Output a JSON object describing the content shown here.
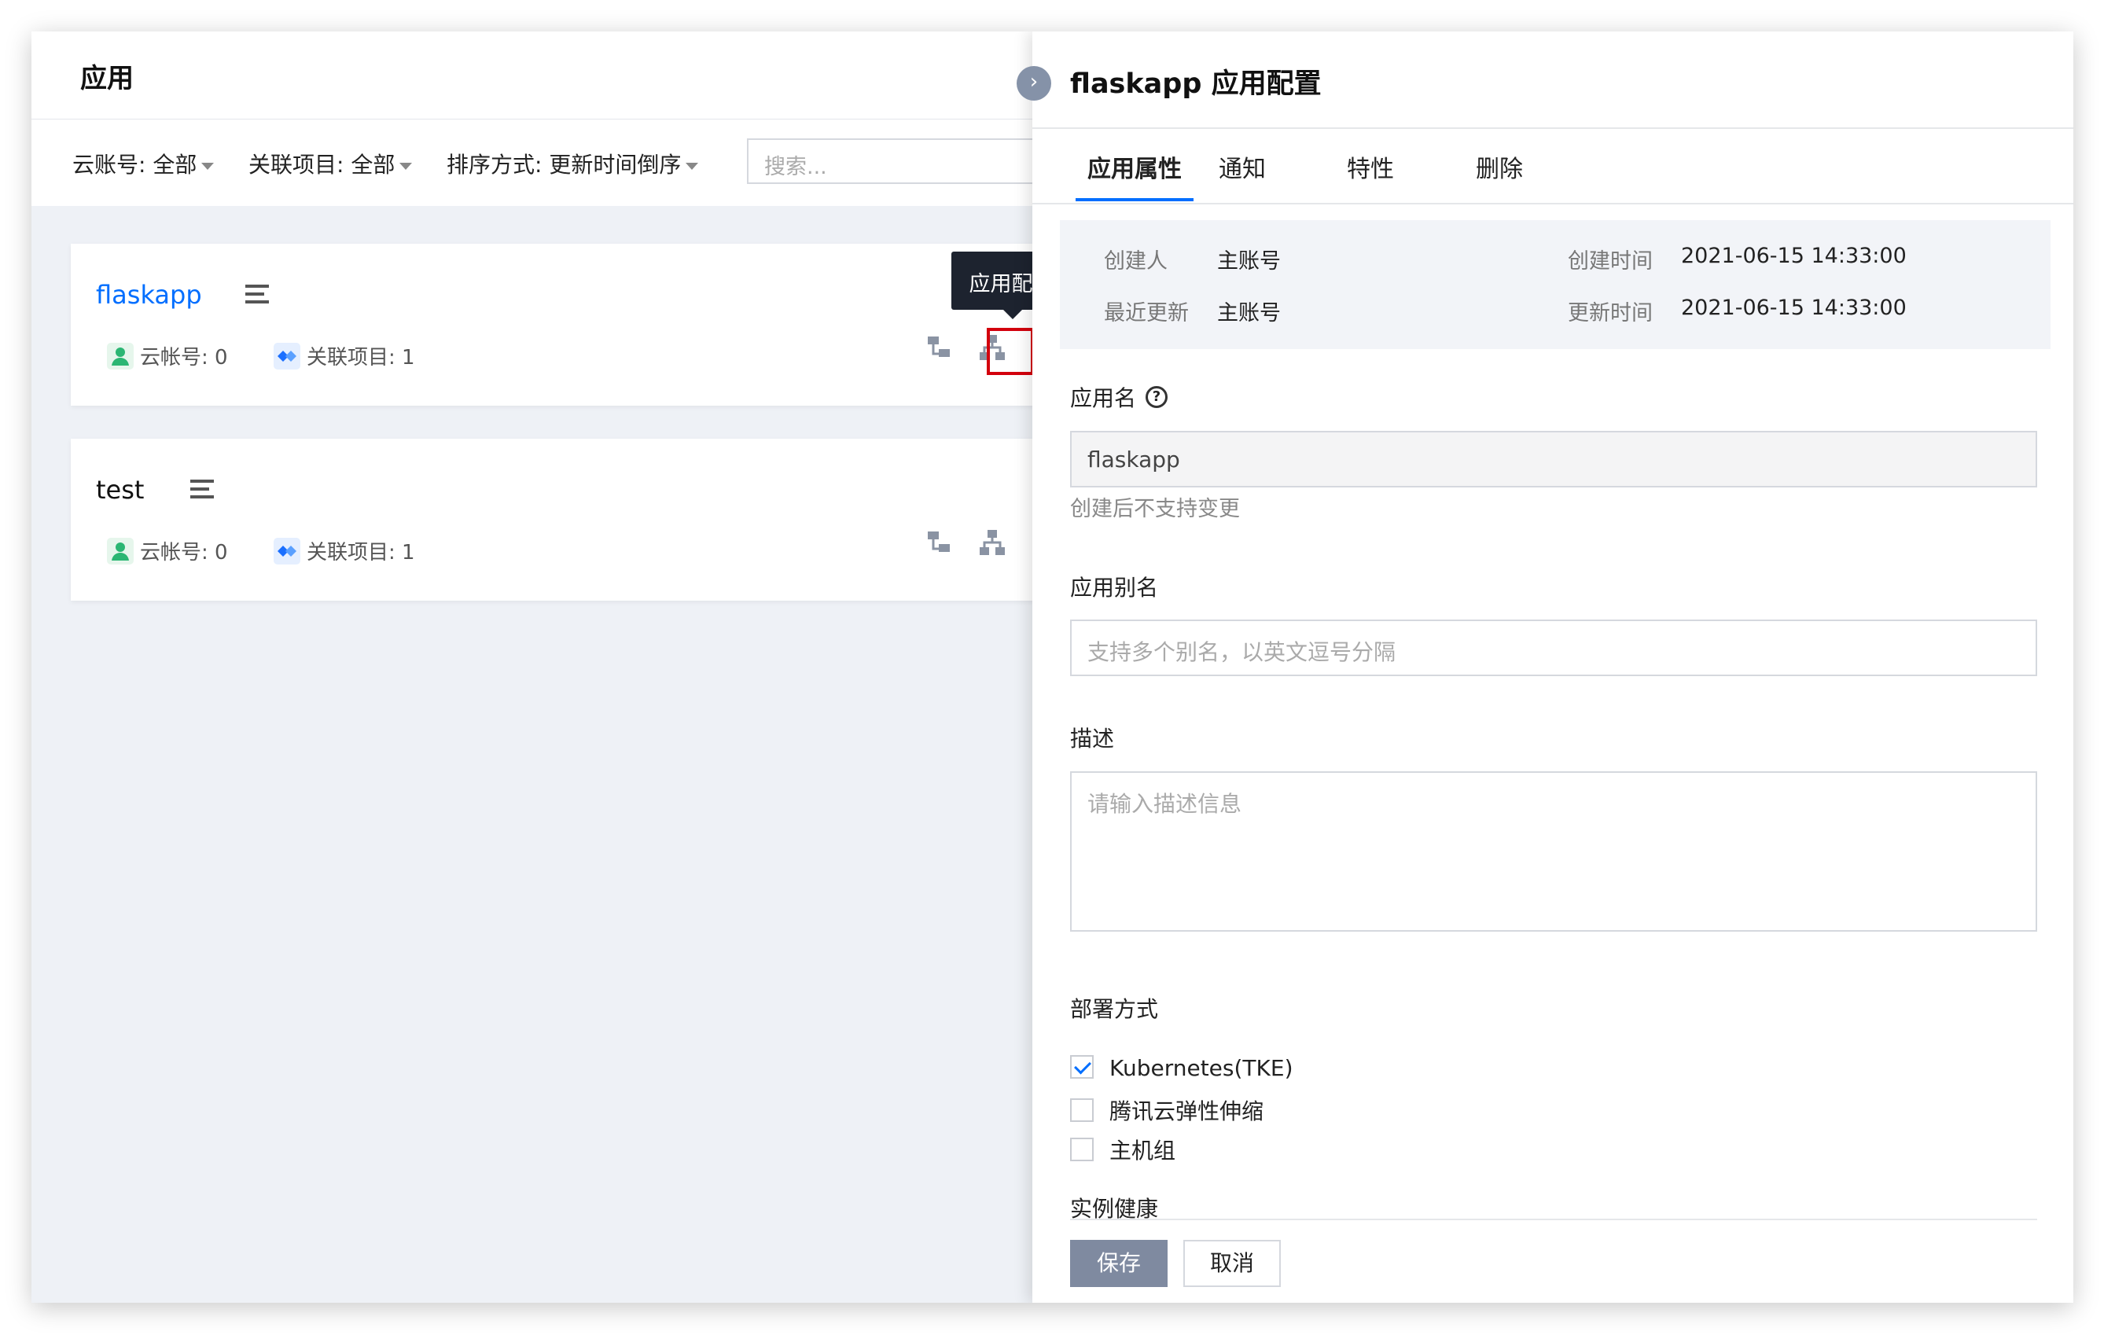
{
  "list": {
    "title": "应用",
    "filters": {
      "account_label": "云账号:",
      "account_value": "全部",
      "project_label": "关联项目:",
      "project_value": "全部",
      "sort_label": "排序方式:",
      "sort_value": "更新时间倒序"
    },
    "search_placeholder": "搜索...",
    "apps": [
      {
        "name": "flaskapp",
        "account_text": "云帐号: 0",
        "project_text": "关联项目: 1"
      },
      {
        "name": "test",
        "account_text": "云帐号: 0",
        "project_text": "关联项目: 1",
        "more": "···"
      }
    ],
    "tooltip": "应用配置"
  },
  "drawer": {
    "collapse_icon": "›",
    "title": "flaskapp 应用配置",
    "tabs": [
      "应用属性",
      "通知",
      "特性",
      "删除"
    ],
    "info": {
      "creator_label": "创建人",
      "creator_value": "主账号",
      "updater_label": "最近更新",
      "updater_value": "主账号",
      "created_label": "创建时间",
      "created_value": "2021-06-15 14:33:00",
      "updated_label": "更新时间",
      "updated_value": "2021-06-15 14:33:00"
    },
    "app_name_label": "应用名",
    "app_name_help": "?",
    "app_name_value": "flaskapp",
    "app_name_hint": "创建后不支持变更",
    "alias_label": "应用别名",
    "alias_placeholder": "支持多个别名，以英文逗号分隔",
    "desc_label": "描述",
    "desc_placeholder": "请输入描述信息",
    "deploy_label": "部署方式",
    "deploy_options": [
      {
        "label": "Kubernetes(TKE)",
        "checked": true
      },
      {
        "label": "腾讯云弹性伸缩",
        "checked": false
      },
      {
        "label": "主机组",
        "checked": false
      }
    ],
    "health_label": "实例健康",
    "save_label": "保存",
    "cancel_label": "取消"
  },
  "colors": {
    "accent": "#006eff",
    "highlight": "#d3000d",
    "primary_button": "#7f8aa0"
  }
}
